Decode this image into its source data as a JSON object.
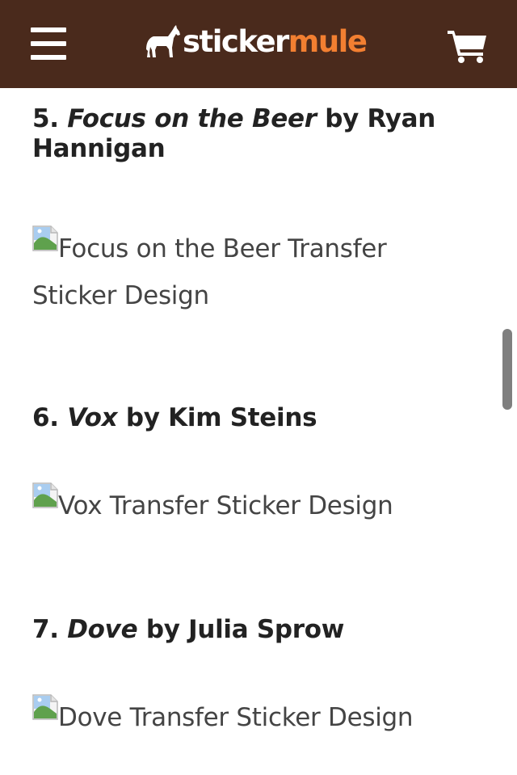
{
  "header": {
    "menu_icon": "hamburger-menu-icon",
    "logo": {
      "part1": "sticker",
      "part2": "mule",
      "icon": "mule-icon"
    },
    "cart_icon": "shopping-cart-icon",
    "colors": {
      "background": "#4a2a1c",
      "accent": "#f27f31",
      "text": "#ffffff"
    }
  },
  "entries": [
    {
      "number": "5.",
      "title": "Focus on the Beer",
      "by": "by Ryan Hannigan",
      "image_alt": "Focus on the Beer Transfer Sticker Design"
    },
    {
      "number": "6.",
      "title": "Vox",
      "by": "by Kim Steins",
      "image_alt": "Vox Transfer Sticker Design"
    },
    {
      "number": "7.",
      "title": "Dove",
      "by": "by Julia Sprow",
      "image_alt": "Dove Transfer Sticker Design"
    }
  ]
}
